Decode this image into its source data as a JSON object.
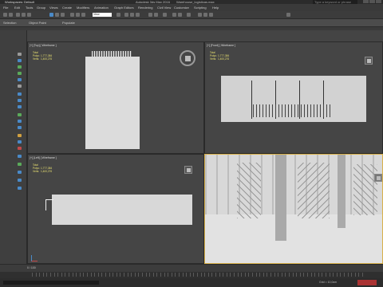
{
  "titlebar": {
    "workspace": "Workspaces: Default",
    "app": "Autodesk 3ds Max 2016",
    "file": "Warehouse_logisticas.max",
    "search_placeholder": "Type a keyword or phrase"
  },
  "menubar": {
    "items": [
      "File",
      "Edit",
      "Tools",
      "Group",
      "Views",
      "Create",
      "Modifiers",
      "Animation",
      "Graph Editors",
      "Rendering",
      "Civil View",
      "Customize",
      "Scripting",
      "Help"
    ]
  },
  "toolbar": {
    "view_select": "View"
  },
  "ribbon": {
    "items": [
      "Selection",
      "Object Paint",
      "Populate"
    ]
  },
  "viewports": {
    "top": {
      "label": "[+] [Top] [ Wireframe ]",
      "total": "Total",
      "polys": "1,777,384",
      "verts": "1,400,276"
    },
    "front": {
      "label": "[+] [Front] [ Wireframe ]",
      "total": "Total",
      "polys": "1,777,384",
      "verts": "1,400,276"
    },
    "left": {
      "label": "[+] [Left] [ Wireframe ]",
      "total": "Total",
      "polys": "1,777,384",
      "verts": "1,400,276"
    },
    "perspective": {
      "label": ""
    }
  },
  "stat_keys": {
    "polys": "Polys:",
    "verts": "Verts:"
  },
  "timeline": {
    "frame": "0 / 100"
  },
  "status": {
    "grid": "Grid = 10,0cm",
    "auto_key": ""
  }
}
